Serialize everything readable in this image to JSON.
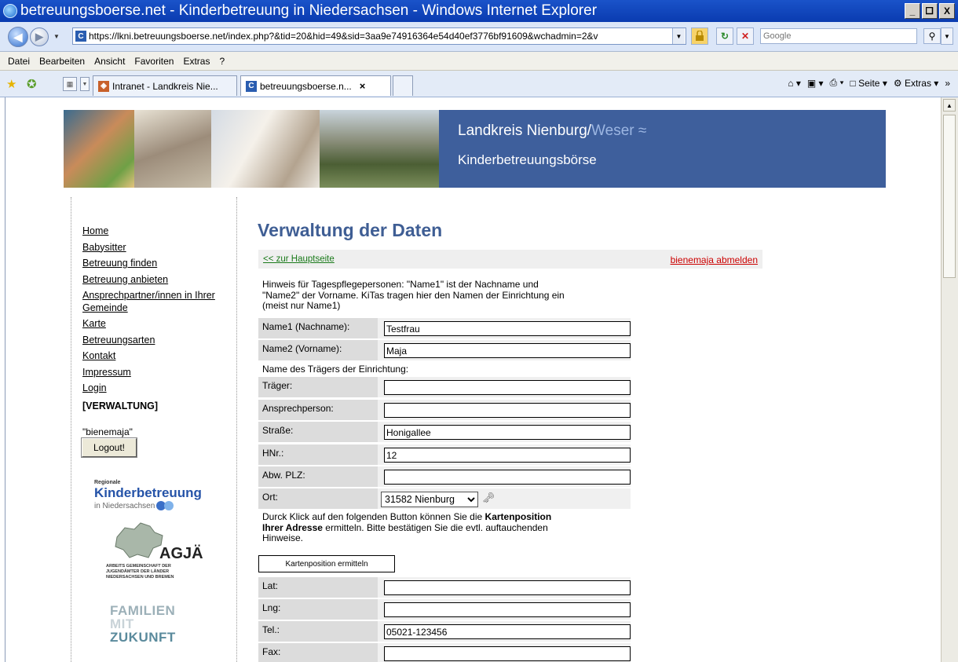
{
  "window": {
    "title": "betreuungsboerse.net - Kinderbetreuung in Niedersachsen - Windows Internet Explorer",
    "min": "_",
    "max": "×",
    "close": "X"
  },
  "addressbar": {
    "url": "https://lkni.betreuungsboerse.net/index.php?&tid=20&hid=49&sid=3aa9e74916364e54d40ef3776bf91609&wchadmin=2&v",
    "search_placeholder": "Google"
  },
  "menu": [
    "Datei",
    "Bearbeiten",
    "Ansicht",
    "Favoriten",
    "Extras",
    "?"
  ],
  "tabs": [
    {
      "label": "Intranet - Landkreis Nie..."
    },
    {
      "label": "betreuungsboerse.n...",
      "close": "×"
    }
  ],
  "commandbar": {
    "page": "Seite",
    "tools": "Extras",
    "chevron": "»"
  },
  "banner": {
    "title_main": "Landkreis Nienburg",
    "title_sep": "/",
    "title_weser": "Weser",
    "waves": "≈",
    "subtitle": "Kinderbetreuungsbörse"
  },
  "nav": {
    "items": [
      "Home",
      "Babysitter",
      "Betreuung finden",
      "Betreuung anbieten",
      "Ansprechpartner/innen in Ihrer Gemeinde",
      "Karte",
      "Betreuungsarten",
      "Kontakt",
      "Impressum",
      "Login"
    ],
    "current": "[VERWALTUNG]",
    "user": "\"bienemaja\"",
    "logout": "Logout!"
  },
  "logos": {
    "regionale": "Regionale",
    "kinderbetreuung": "Kinderbetreuung",
    "niedersachsen": "in Niedersachsen",
    "agja": "AGJÄ",
    "agja_sub1": "Arbeits    gemeinschaft der",
    "agja_sub2": "Jugendämter der Länder",
    "agja_sub3": "Niedersachsen und Bremen",
    "fam1": "FAMILIEN",
    "fam2": "MIT",
    "fam3": "ZUKUNFT"
  },
  "main": {
    "title": "Verwaltung der Daten",
    "back_link": "<< zur Hauptseite",
    "logout_link": "bienemaja abmelden",
    "hint1a": "Hinweis für Tagespflegepersonen: \"Name1\" ist der Nachname und",
    "hint1b": "\"Name2\" der Vorname. KiTas tragen hier den Namen der Einrichtung ein",
    "hint1c": "(meist nur Name1)",
    "hint2": "Name des Trägers der Einrichtung:",
    "hint3a_pre": "Durck Klick auf den folgenden Button können Sie die ",
    "hint3a_bold": "Kartenposition",
    "hint3b_bold": "Ihrer Adresse",
    "hint3b_post": " ermitteln. Bitte bestätigen Sie die evtl. auftauchenden",
    "hint3c": "Hinweise.",
    "map_button": "Kartenposition ermitteln",
    "fields": {
      "name1": {
        "label": "Name1 (Nachname):",
        "value": "Testfrau"
      },
      "name2": {
        "label": "Name2 (Vorname):",
        "value": "Maja"
      },
      "traeger": {
        "label": "Träger:",
        "value": ""
      },
      "ansprech": {
        "label": "Ansprechperson:",
        "value": ""
      },
      "strasse": {
        "label": "Straße:",
        "value": "Honigallee"
      },
      "hnr": {
        "label": "HNr.:",
        "value": "12"
      },
      "abwplz": {
        "label": "Abw. PLZ:",
        "value": ""
      },
      "ort": {
        "label": "Ort:",
        "value": "31582 Nienburg"
      },
      "lat": {
        "label": "Lat:",
        "value": ""
      },
      "lng": {
        "label": "Lng:",
        "value": ""
      },
      "tel": {
        "label": "Tel.:",
        "value": "05021-123456"
      },
      "fax": {
        "label": "Fax:",
        "value": ""
      }
    }
  },
  "colors": {
    "brand_blue": "#3e5f9c",
    "title_blue": "#3f5e94",
    "link_green": "#1a7a1a",
    "logout_red": "#cc0000"
  }
}
